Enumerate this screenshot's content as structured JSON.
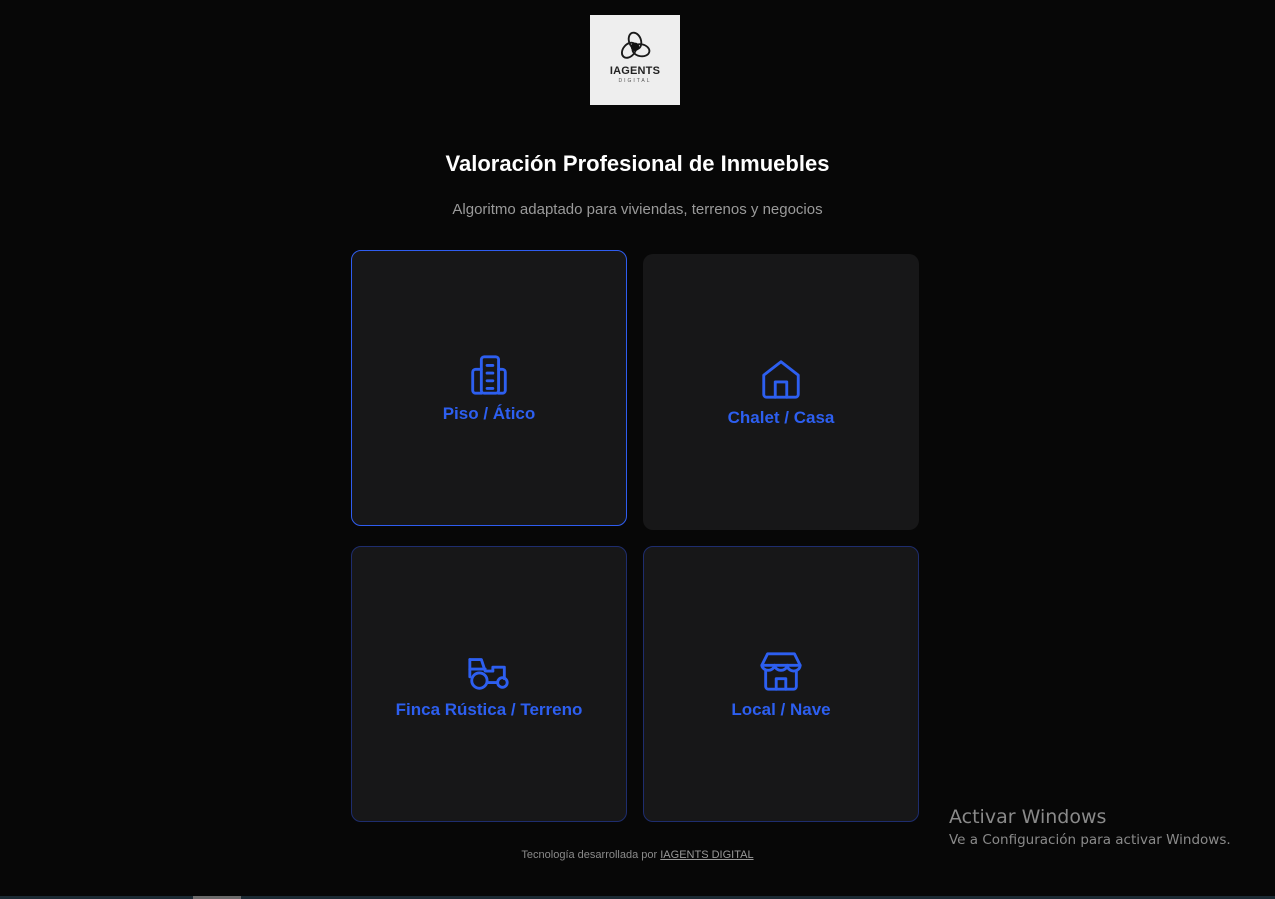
{
  "brand": {
    "name": "IAGENTS",
    "sub": "DIGITAL",
    "logo_icon": "spiral-logo-icon"
  },
  "header": {
    "title": "Valoración Profesional de Inmuebles",
    "subtitle": "Algoritmo adaptado para viviendas, terrenos y negocios"
  },
  "options": [
    {
      "label": "Piso / Ático",
      "icon": "building-icon",
      "state": "selected"
    },
    {
      "label": "Chalet / Casa",
      "icon": "house-icon",
      "state": "hover"
    },
    {
      "label": "Finca Rústica / Terreno",
      "icon": "tractor-icon",
      "state": "default"
    },
    {
      "label": "Local / Nave",
      "icon": "store-icon",
      "state": "default"
    }
  ],
  "footer": {
    "text": "Tecnología desarrollada por",
    "link": "IAGENTS DIGITAL"
  },
  "watermark": {
    "title": "Activar Windows",
    "subtitle": "Ve a Configuración para activar Windows."
  },
  "colors": {
    "background": "#070707",
    "card": "#171718",
    "accent": "#2d5ff0",
    "muted_text": "#9a9a9a"
  }
}
